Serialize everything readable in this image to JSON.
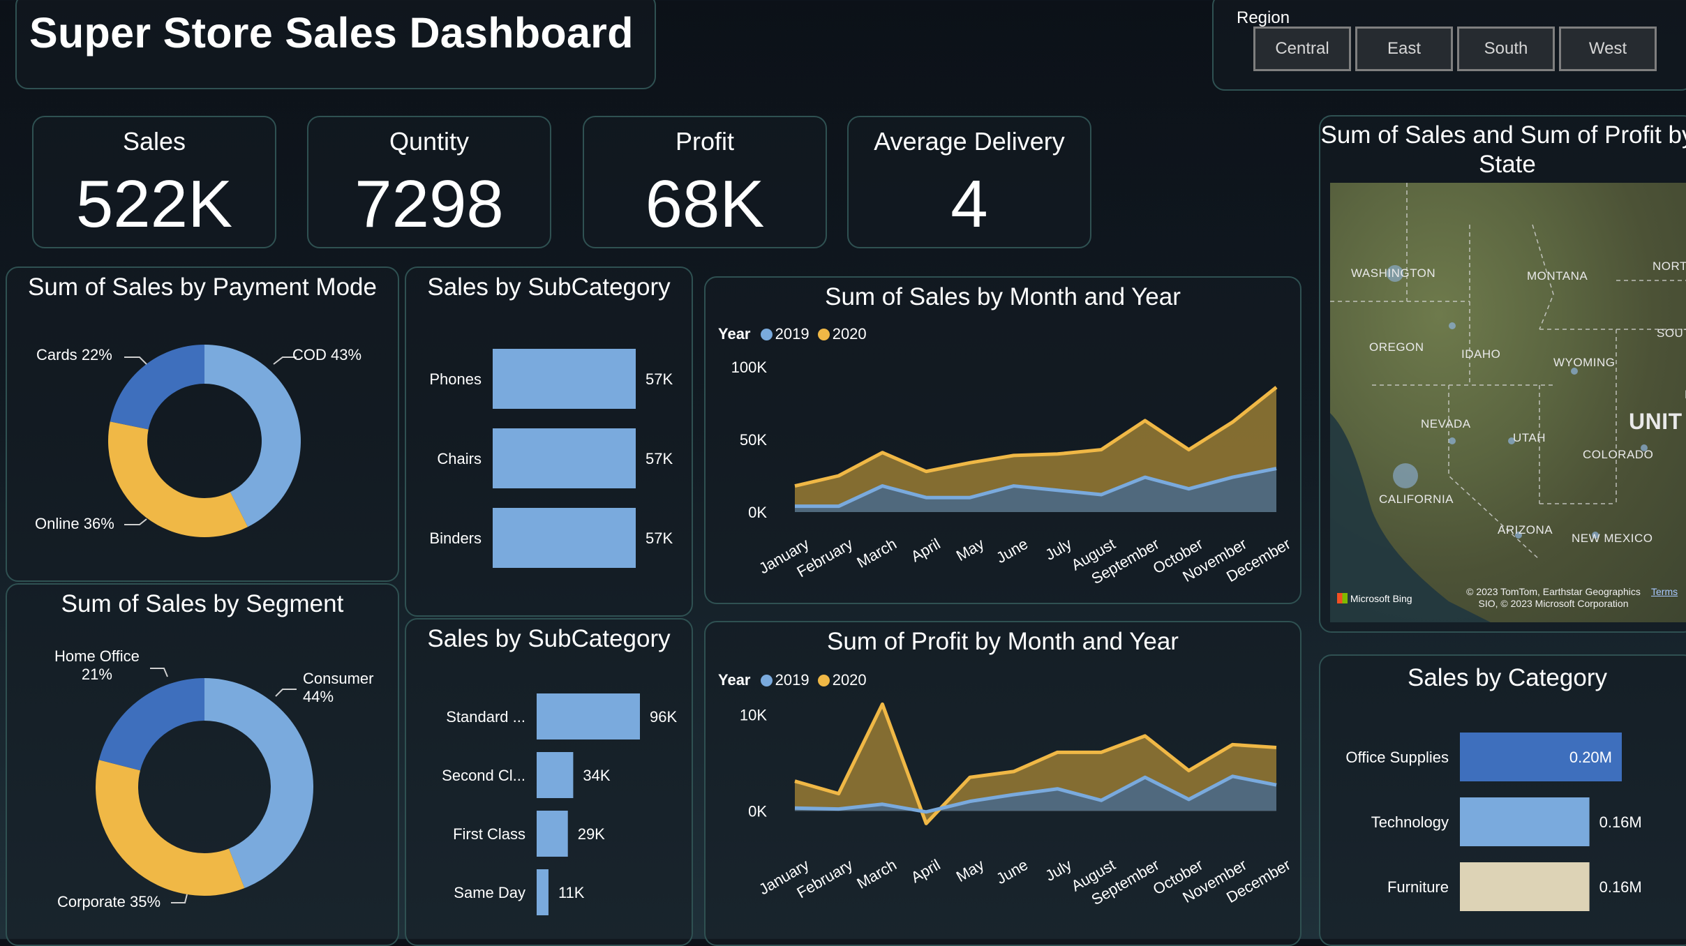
{
  "title": "Super Store Sales Dashboard",
  "region": {
    "label": "Region",
    "options": [
      "Central",
      "East",
      "South",
      "West"
    ]
  },
  "kpis": [
    {
      "label": "Sales",
      "value": "522K"
    },
    {
      "label": "Quntity",
      "value": "7298"
    },
    {
      "label": "Profit",
      "value": "68K"
    },
    {
      "label": "Average Delivery",
      "value": "4"
    }
  ],
  "payment_mode": {
    "title": "Sum of Sales by Payment Mode",
    "slices": [
      {
        "label": "COD",
        "pct": "43%",
        "value": 43,
        "color": "#7aaadd"
      },
      {
        "label": "Online",
        "pct": "36%",
        "value": 36,
        "color": "#f0b846"
      },
      {
        "label": "Cards",
        "pct": "22%",
        "value": 22,
        "color": "#3e6fbd"
      }
    ]
  },
  "segment": {
    "title": "Sum of Sales by Segment",
    "slices": [
      {
        "label": "Consumer",
        "pct": "44%",
        "value": 44,
        "color": "#7aaadd"
      },
      {
        "label": "Corporate",
        "pct": "35%",
        "value": 35,
        "color": "#f0b846"
      },
      {
        "label": "Home Office",
        "pct": "21%",
        "value": 21,
        "color": "#3e6fbd"
      }
    ]
  },
  "subcat1": {
    "title": "Sales by SubCategory",
    "items": [
      {
        "label": "Phones",
        "value": 57,
        "text": "57K"
      },
      {
        "label": "Chairs",
        "value": 57,
        "text": "57K"
      },
      {
        "label": "Binders",
        "value": 57,
        "text": "57K"
      }
    ]
  },
  "subcat2": {
    "title": "Sales by SubCategory",
    "items": [
      {
        "label": "Standard ...",
        "value": 96,
        "text": "96K"
      },
      {
        "label": "Second Cl...",
        "value": 34,
        "text": "34K"
      },
      {
        "label": "First Class",
        "value": 29,
        "text": "29K"
      },
      {
        "label": "Same Day",
        "value": 11,
        "text": "11K"
      }
    ]
  },
  "sales_month": {
    "title": "Sum of Sales by Month and Year",
    "legend_title": "Year",
    "series_names": [
      "2019",
      "2020"
    ],
    "y_ticks": [
      "100K",
      "50K",
      "0K"
    ]
  },
  "profit_month": {
    "title": "Sum of Profit by Month and Year",
    "legend_title": "Year",
    "series_names": [
      "2019",
      "2020"
    ],
    "y_ticks": [
      "10K",
      "0K"
    ]
  },
  "map": {
    "title": "Sum of Sales and Sum of Profit by State",
    "states": [
      "WASHINGTON",
      "MONTANA",
      "NORTH",
      "OREGON",
      "IDAHO",
      "WYOMING",
      "SOUT",
      "NEVADA",
      "UTAH",
      "UNIT",
      "COLORADO",
      "CALIFORNIA",
      "ARIZONA",
      "NEW MEXICO",
      "N"
    ],
    "attribution": "© 2023 TomTom, Earthstar Geographics SIO, © 2023 Microsoft Corporation",
    "terms": "Terms",
    "brand": "Microsoft Bing"
  },
  "category": {
    "title": "Sales by Category",
    "items": [
      {
        "label": "Office Supplies",
        "value": 0.2,
        "text": "0.20M",
        "color": "#3e6fbd"
      },
      {
        "label": "Technology",
        "value": 0.16,
        "text": "0.16M",
        "color": "#7aaadd"
      },
      {
        "label": "Furniture",
        "value": 0.16,
        "text": "0.16M",
        "color": "#ddd3b6"
      }
    ]
  },
  "chart_data": [
    {
      "type": "pie",
      "title": "Sum of Sales by Payment Mode",
      "categories": [
        "COD",
        "Online",
        "Cards"
      ],
      "values": [
        43,
        36,
        22
      ]
    },
    {
      "type": "pie",
      "title": "Sum of Sales by Segment",
      "categories": [
        "Consumer",
        "Corporate",
        "Home Office"
      ],
      "values": [
        44,
        35,
        21
      ]
    },
    {
      "type": "bar",
      "title": "Sales by SubCategory",
      "categories": [
        "Phones",
        "Chairs",
        "Binders"
      ],
      "values": [
        57,
        57,
        57
      ]
    },
    {
      "type": "bar",
      "title": "Sales by SubCategory",
      "categories": [
        "Standard ...",
        "Second Cl...",
        "First Class",
        "Same Day"
      ],
      "values": [
        96,
        34,
        29,
        11
      ]
    },
    {
      "type": "area",
      "title": "Sum of Sales by Month and Year",
      "x": [
        "January",
        "February",
        "March",
        "April",
        "May",
        "June",
        "July",
        "August",
        "September",
        "October",
        "November",
        "December"
      ],
      "series": [
        {
          "name": "2019",
          "values": [
            4,
            4,
            18,
            10,
            10,
            18,
            15,
            12,
            24,
            16,
            24,
            30
          ]
        },
        {
          "name": "2020",
          "values": [
            18,
            25,
            41,
            28,
            34,
            39,
            40,
            43,
            63,
            43,
            62,
            86
          ]
        }
      ],
      "ylim": [
        0,
        100
      ]
    },
    {
      "type": "area",
      "title": "Sum of Profit by Month and Year",
      "x": [
        "January",
        "February",
        "March",
        "April",
        "May",
        "June",
        "July",
        "August",
        "September",
        "October",
        "November",
        "December"
      ],
      "series": [
        {
          "name": "2019",
          "values": [
            0.3,
            0.2,
            0.7,
            -0.1,
            1.0,
            1.7,
            2.3,
            1.1,
            3.5,
            1.2,
            3.6,
            2.7
          ]
        },
        {
          "name": "2020",
          "values": [
            3.1,
            1.8,
            11.1,
            -1.3,
            3.5,
            4.1,
            6.1,
            6.1,
            7.8,
            4.2,
            6.9,
            6.6
          ]
        }
      ],
      "ylim": [
        -2,
        12
      ]
    },
    {
      "type": "bar",
      "title": "Sales by Category",
      "categories": [
        "Office Supplies",
        "Technology",
        "Furniture"
      ],
      "values": [
        0.2,
        0.16,
        0.16
      ]
    }
  ]
}
